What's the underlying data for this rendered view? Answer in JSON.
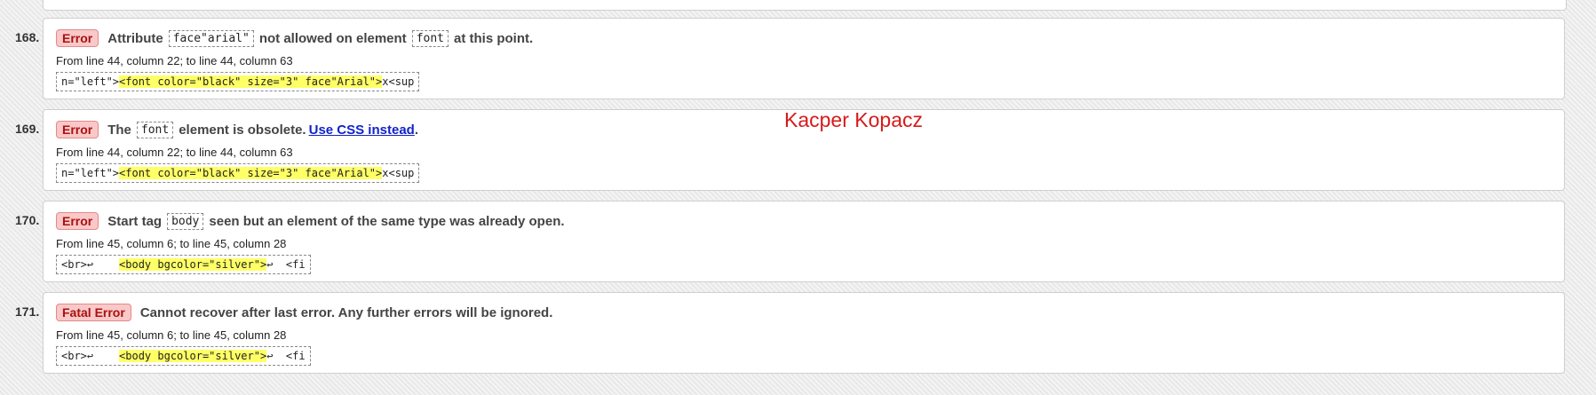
{
  "watermark": "Kacper Kopacz",
  "messages": [
    {
      "number": "168.",
      "badge": "Error",
      "parts": [
        "Attribute",
        "face\"arial\"",
        "not allowed on element",
        "font",
        "at this point."
      ],
      "location": "From line 44, column 22; to line 44, column 63",
      "extract_pre": "n=\"left\">",
      "extract_hl": "<font color=\"black\" size=\"3\" face\"Arial\">",
      "extract_post": "x<sup"
    },
    {
      "number": "169.",
      "badge": "Error",
      "parts": [
        "The",
        "font",
        "element is obsolete.",
        "Use CSS instead",
        "."
      ],
      "location": "From line 44, column 22; to line 44, column 63",
      "extract_pre": "n=\"left\">",
      "extract_hl": "<font color=\"black\" size=\"3\" face\"Arial\">",
      "extract_post": "x<sup"
    },
    {
      "number": "170.",
      "badge": "Error",
      "parts": [
        "Start tag",
        "body",
        "seen but an element of the same type was already open."
      ],
      "location": "From line 45, column 6; to line 45, column 28",
      "extract_pre": "<br>↩    ",
      "extract_hl": "<body bgcolor=\"silver\">",
      "extract_post": "↩  <fi"
    },
    {
      "number": "171.",
      "badge": "Fatal Error",
      "parts": [
        "Cannot recover after last error. Any further errors will be ignored."
      ],
      "location": "From line 45, column 6; to line 45, column 28",
      "extract_pre": "<br>↩    ",
      "extract_hl": "<body bgcolor=\"silver\">",
      "extract_post": "↩  <fi"
    }
  ]
}
